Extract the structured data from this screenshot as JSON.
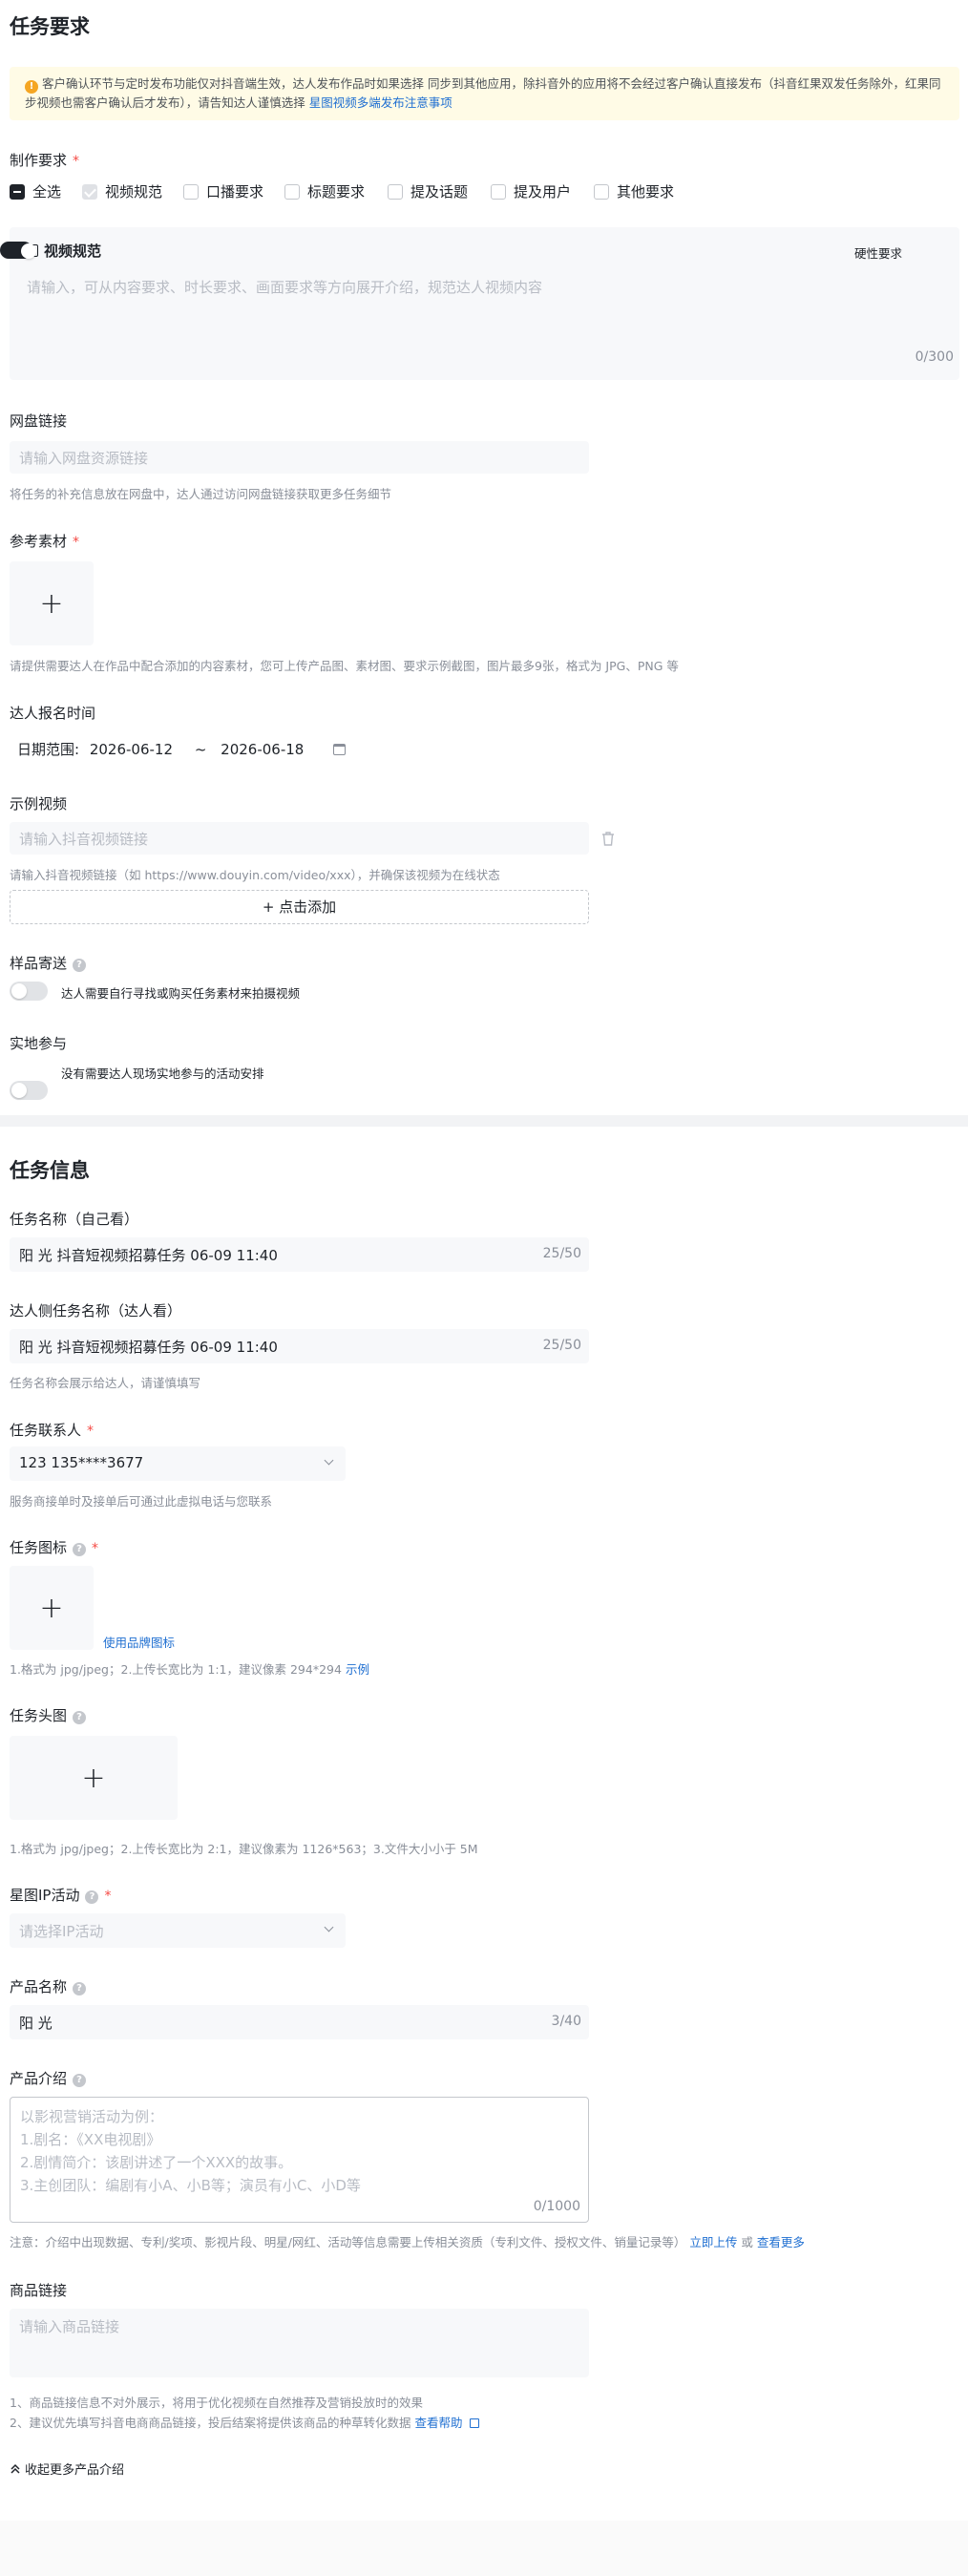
{
  "task_requirements": {
    "title": "任务要求",
    "notice": {
      "text1": "客户确认环节与定时发布功能仅对抖音端生效，达人发布作品时如果选择 同步到其他应用，除抖音外的应用将不会经过客户确认直接发布（抖音红果双发任务除外，红果同步视频也需客户确认后才发布），请告知达人谨慎选择",
      "link": "星图视频多端发布注意事项"
    },
    "production": {
      "label": "制作要求",
      "required": "*",
      "options": [
        {
          "label": "全选",
          "state": "indeterminate"
        },
        {
          "label": "视频规范",
          "state": "checked"
        },
        {
          "label": "口播要求",
          "state": "unchecked"
        },
        {
          "label": "标题要求",
          "state": "unchecked"
        },
        {
          "label": "提及话题",
          "state": "unchecked"
        },
        {
          "label": "提及用户",
          "state": "unchecked"
        },
        {
          "label": "其他要求",
          "state": "unchecked"
        }
      ],
      "video_spec": {
        "title": "视频规范",
        "hard_label": "硬性要求",
        "hard_on": true,
        "placeholder": "请输入，可从内容要求、时长要求、画面要求等方向展开介绍，规范达人视频内容",
        "count": "0/300"
      }
    },
    "netdisk": {
      "label": "网盘链接",
      "placeholder": "请输入网盘资源链接",
      "hint": "将任务的补充信息放在网盘中，达人通过访问网盘链接获取更多任务细节"
    },
    "reference": {
      "label": "参考素材",
      "required": "*",
      "upload_symbol": "+",
      "hint": "请提供需要达人在作品中配合添加的内容素材，您可上传产品图、素材图、要求示例截图，图片最多9张，格式为 JPG、PNG 等"
    },
    "signup_time": {
      "label": "达人报名时间",
      "prefix": "日期范围:",
      "start": "2026-06-12",
      "separator": "~",
      "end": "2026-06-18"
    },
    "sample_video": {
      "label": "示例视频",
      "placeholder": "请输入抖音视频链接",
      "hint": "请输入抖音视频链接（如 https://www.douyin.com/video/xxx），并确保该视频为在线状态",
      "add_button": "+ 点击添加"
    },
    "sample_send": {
      "label": "样品寄送",
      "toggle_text": "达人需要自行寻找或购买任务素材来拍摄视频"
    },
    "onsite": {
      "label": "实地参与",
      "toggle_text": "没有需要达人现场实地参与的活动安排"
    }
  },
  "task_info": {
    "title": "任务信息",
    "name_self": {
      "label": "任务名称（自己看）",
      "value": "阳 光 抖音短视频招募任务 06-09 11:40",
      "count": "25/50"
    },
    "name_creator": {
      "label": "达人侧任务名称（达人看）",
      "value": "阳 光 抖音短视频招募任务 06-09 11:40",
      "count": "25/50",
      "hint": "任务名称会展示给达人，请谨慎填写"
    },
    "contact": {
      "label": "任务联系人",
      "required": "*",
      "value": "123 135****3677",
      "hint": "服务商接单时及接单后可通过此虚拟电话与您联系"
    },
    "icon": {
      "label": "任务图标",
      "required": "*",
      "upload_symbol": "+",
      "brand_link": "使用品牌图标",
      "hint": "1.格式为 jpg/jpeg；2.上传长宽比为 1:1，建议像素 294*294",
      "example_link": "示例"
    },
    "header_image": {
      "label": "任务头图",
      "upload_symbol": "+",
      "hint": "1.格式为 jpg/jpeg；2.上传长宽比为 2:1，建议像素为 1126*563；3.文件大小小于 5M"
    },
    "ip_activity": {
      "label": "星图IP活动",
      "required": "*",
      "placeholder": "请选择IP活动"
    },
    "product_name": {
      "label": "产品名称",
      "value": "阳 光",
      "count": "3/40"
    },
    "product_intro": {
      "label": "产品介绍",
      "placeholder_lines": [
        "以影视营销活动为例：",
        "1.剧名：《XX电视剧》",
        "2.剧情简介：该剧讲述了一个XXX的故事。",
        "3.主创团队：编剧有小A、小B等；演员有小C、小D等"
      ],
      "count": "0/1000",
      "hint": "注意：介绍中出现数据、专利/奖项、影视片段、明星/网红、活动等信息需要上传相关资质（专利文件、授权文件、销量记录等）",
      "upload_link": "立即上传",
      "or": "或",
      "more_link": "查看更多"
    },
    "product_link": {
      "label": "商品链接",
      "placeholder": "请输入商品链接",
      "hint1": "1、商品链接信息不对外展示，将用于优化视频在自然推荐及营销投放时的效果",
      "hint2": "2、建议优先填写抖音电商商品链接，投后结案将提供该商品的种草转化数据",
      "help_link": "查看帮助"
    },
    "collapse": "收起更多产品介绍"
  }
}
